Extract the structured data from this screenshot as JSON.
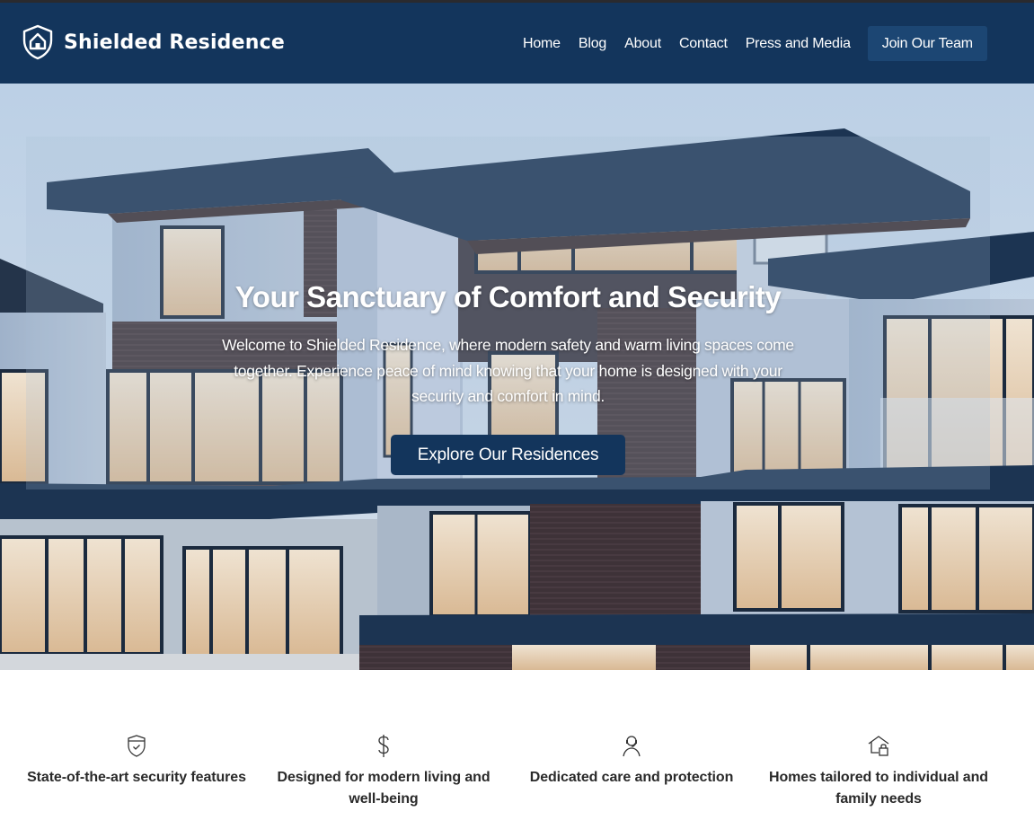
{
  "header": {
    "brand_name": "Shielded Residence",
    "logo_icon": "shield-home-icon",
    "nav_links": [
      "Home",
      "Blog",
      "About",
      "Contact",
      "Press and Media"
    ],
    "cta_label": "Join Our Team"
  },
  "hero": {
    "title": "Your Sanctuary of Comfort and Security",
    "text": "Welcome to Shielded Residence, where modern safety and warm living spaces come together. Experience peace of mind knowing that your home is designed with your security and comfort in mind.",
    "cta_label": "Explore Our Residences",
    "background": "modern-residential-building-photo"
  },
  "features": [
    {
      "icon": "shield-check-icon",
      "label": "State-of-the-art security features"
    },
    {
      "icon": "dollar-icon",
      "label": "Designed for modern living and well-being"
    },
    {
      "icon": "support-agent-icon",
      "label": "Dedicated care and protection"
    },
    {
      "icon": "home-lock-icon",
      "label": "Homes tailored to individual and family needs"
    }
  ],
  "colors": {
    "navbar": "#13355c",
    "nav_cta": "#1c4673",
    "hero_cta": "#13355c",
    "text_dark": "#2a2a2a"
  }
}
